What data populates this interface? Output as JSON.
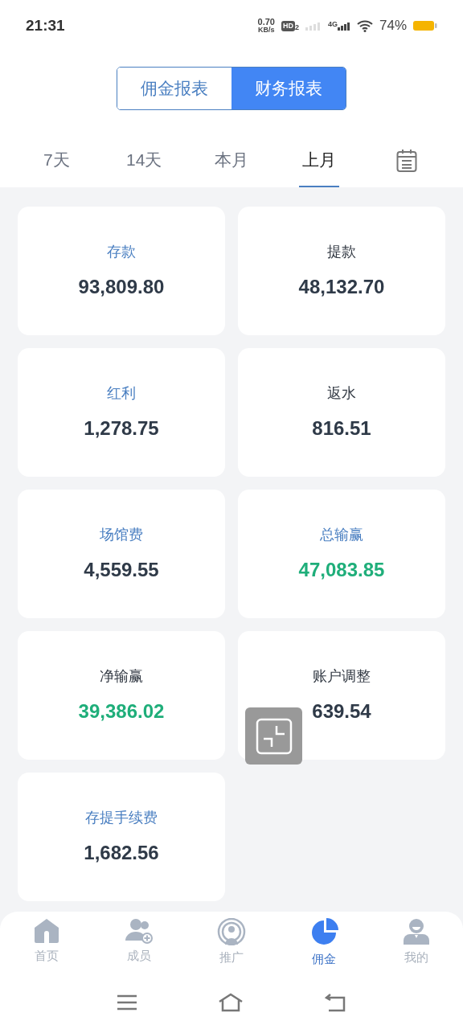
{
  "status_bar": {
    "time": "21:31",
    "speed_value": "0.70",
    "speed_unit": "KB/s",
    "hd_label": "HD",
    "sim_slot": "2",
    "network": "4G",
    "battery": "74%"
  },
  "report_tabs": [
    {
      "label": "佣金报表",
      "selected": false
    },
    {
      "label": "财务报表",
      "selected": true
    }
  ],
  "period_tabs": [
    {
      "label": "7天",
      "selected": false
    },
    {
      "label": "14天",
      "selected": false
    },
    {
      "label": "本月",
      "selected": false
    },
    {
      "label": "上月",
      "selected": true
    }
  ],
  "cards": [
    {
      "label": "存款",
      "value": "93,809.80",
      "highlighted": true,
      "positive": false
    },
    {
      "label": "提款",
      "value": "48,132.70",
      "highlighted": false,
      "positive": false
    },
    {
      "label": "红利",
      "value": "1,278.75",
      "highlighted": true,
      "positive": false
    },
    {
      "label": "返水",
      "value": "816.51",
      "highlighted": false,
      "positive": false
    },
    {
      "label": "场馆费",
      "value": "4,559.55",
      "highlighted": true,
      "positive": false
    },
    {
      "label": "总输赢",
      "value": "47,083.85",
      "highlighted": true,
      "positive": true
    },
    {
      "label": "净输赢",
      "value": "39,386.02",
      "highlighted": false,
      "positive": true
    },
    {
      "label": "账户调整",
      "value": "639.54",
      "highlighted": false,
      "positive": false
    },
    {
      "label": "存提手续费",
      "value": "1,682.56",
      "highlighted": true,
      "positive": false
    }
  ],
  "bottom_nav": [
    {
      "label": "首页",
      "kind": "home",
      "selected": false
    },
    {
      "label": "成员",
      "kind": "members",
      "selected": false
    },
    {
      "label": "推广",
      "kind": "promote",
      "selected": false
    },
    {
      "label": "佣金",
      "kind": "commission",
      "selected": true
    },
    {
      "label": "我的",
      "kind": "profile",
      "selected": false
    }
  ]
}
